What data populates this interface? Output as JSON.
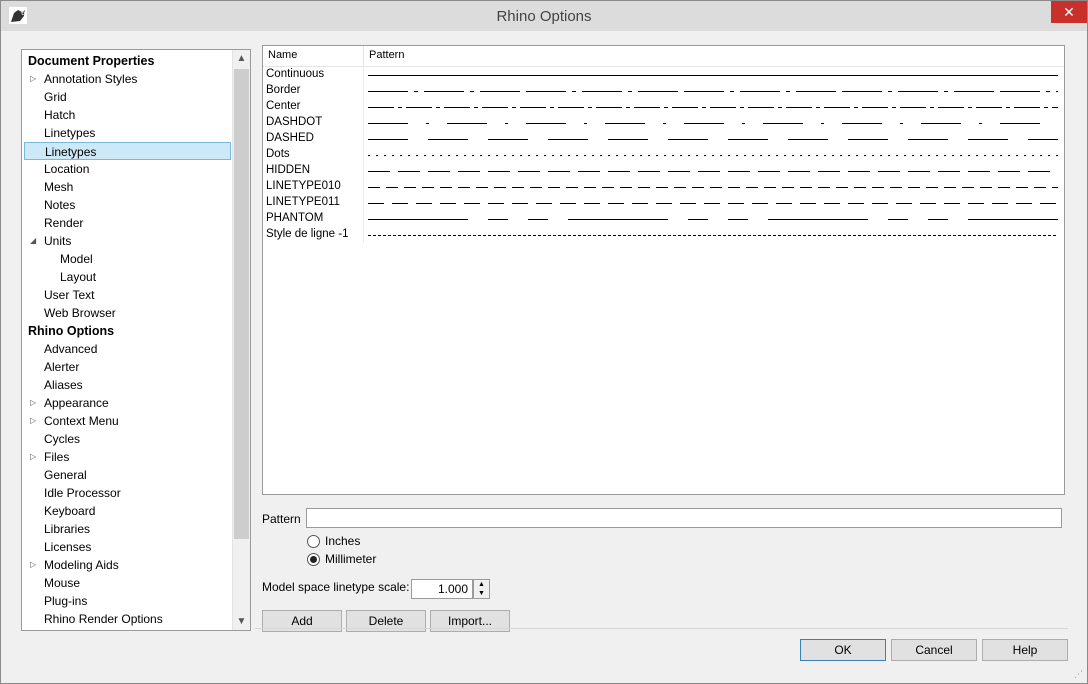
{
  "window": {
    "title": "Rhino Options",
    "close_icon": "close-icon",
    "app_icon": "rhino-app-icon"
  },
  "tree": {
    "items": [
      {
        "label": "Document Properties",
        "level": 0,
        "header": true
      },
      {
        "label": "Annotation Styles",
        "level": 1,
        "expander": "collapsed"
      },
      {
        "label": "Grid",
        "level": 1
      },
      {
        "label": "Hatch",
        "level": 1
      },
      {
        "label": "Linetypes",
        "level": 1
      },
      {
        "label": "Linetypes",
        "level": 1,
        "selected": true
      },
      {
        "label": "Location",
        "level": 1
      },
      {
        "label": "Mesh",
        "level": 1
      },
      {
        "label": "Notes",
        "level": 1
      },
      {
        "label": "Render",
        "level": 1
      },
      {
        "label": "Units",
        "level": 1,
        "expander": "expanded"
      },
      {
        "label": "Model",
        "level": 2
      },
      {
        "label": "Layout",
        "level": 2
      },
      {
        "label": "User Text",
        "level": 1
      },
      {
        "label": "Web Browser",
        "level": 1
      },
      {
        "label": "Rhino Options",
        "level": 0,
        "header": true
      },
      {
        "label": "Advanced",
        "level": 1
      },
      {
        "label": "Alerter",
        "level": 1
      },
      {
        "label": "Aliases",
        "level": 1
      },
      {
        "label": "Appearance",
        "level": 1,
        "expander": "collapsed"
      },
      {
        "label": "Context Menu",
        "level": 1,
        "expander": "collapsed"
      },
      {
        "label": "Cycles",
        "level": 1
      },
      {
        "label": "Files",
        "level": 1,
        "expander": "collapsed"
      },
      {
        "label": "General",
        "level": 1
      },
      {
        "label": "Idle Processor",
        "level": 1
      },
      {
        "label": "Keyboard",
        "level": 1
      },
      {
        "label": "Libraries",
        "level": 1
      },
      {
        "label": "Licenses",
        "level": 1
      },
      {
        "label": "Modeling Aids",
        "level": 1,
        "expander": "collapsed"
      },
      {
        "label": "Mouse",
        "level": 1
      },
      {
        "label": "Plug-ins",
        "level": 1
      },
      {
        "label": "Rhino Render Options",
        "level": 1
      }
    ]
  },
  "linetypes": {
    "columns": [
      "Name",
      "Pattern"
    ],
    "rows": [
      {
        "name": "Continuous",
        "pattern": "continuous"
      },
      {
        "name": "Border",
        "pattern": "border"
      },
      {
        "name": "Center",
        "pattern": "center"
      },
      {
        "name": "DASHDOT",
        "pattern": "dashdot"
      },
      {
        "name": "DASHED",
        "pattern": "dashed"
      },
      {
        "name": "Dots",
        "pattern": "dots"
      },
      {
        "name": "HIDDEN",
        "pattern": "hidden"
      },
      {
        "name": "LINETYPE010",
        "pattern": "lt010"
      },
      {
        "name": "LINETYPE011",
        "pattern": "lt011"
      },
      {
        "name": "PHANTOM",
        "pattern": "phantom"
      },
      {
        "name": "Style de ligne -1",
        "pattern": "fine"
      }
    ]
  },
  "pattern_field": {
    "label": "Pattern",
    "value": ""
  },
  "units": {
    "options": [
      {
        "label": "Inches",
        "checked": false
      },
      {
        "label": "Millimeter",
        "checked": true
      }
    ]
  },
  "scale": {
    "label": "Model space linetype scale:",
    "value": "1.000"
  },
  "actions": {
    "add": "Add",
    "delete": "Delete",
    "import": "Import..."
  },
  "footer": {
    "ok": "OK",
    "cancel": "Cancel",
    "help": "Help"
  }
}
